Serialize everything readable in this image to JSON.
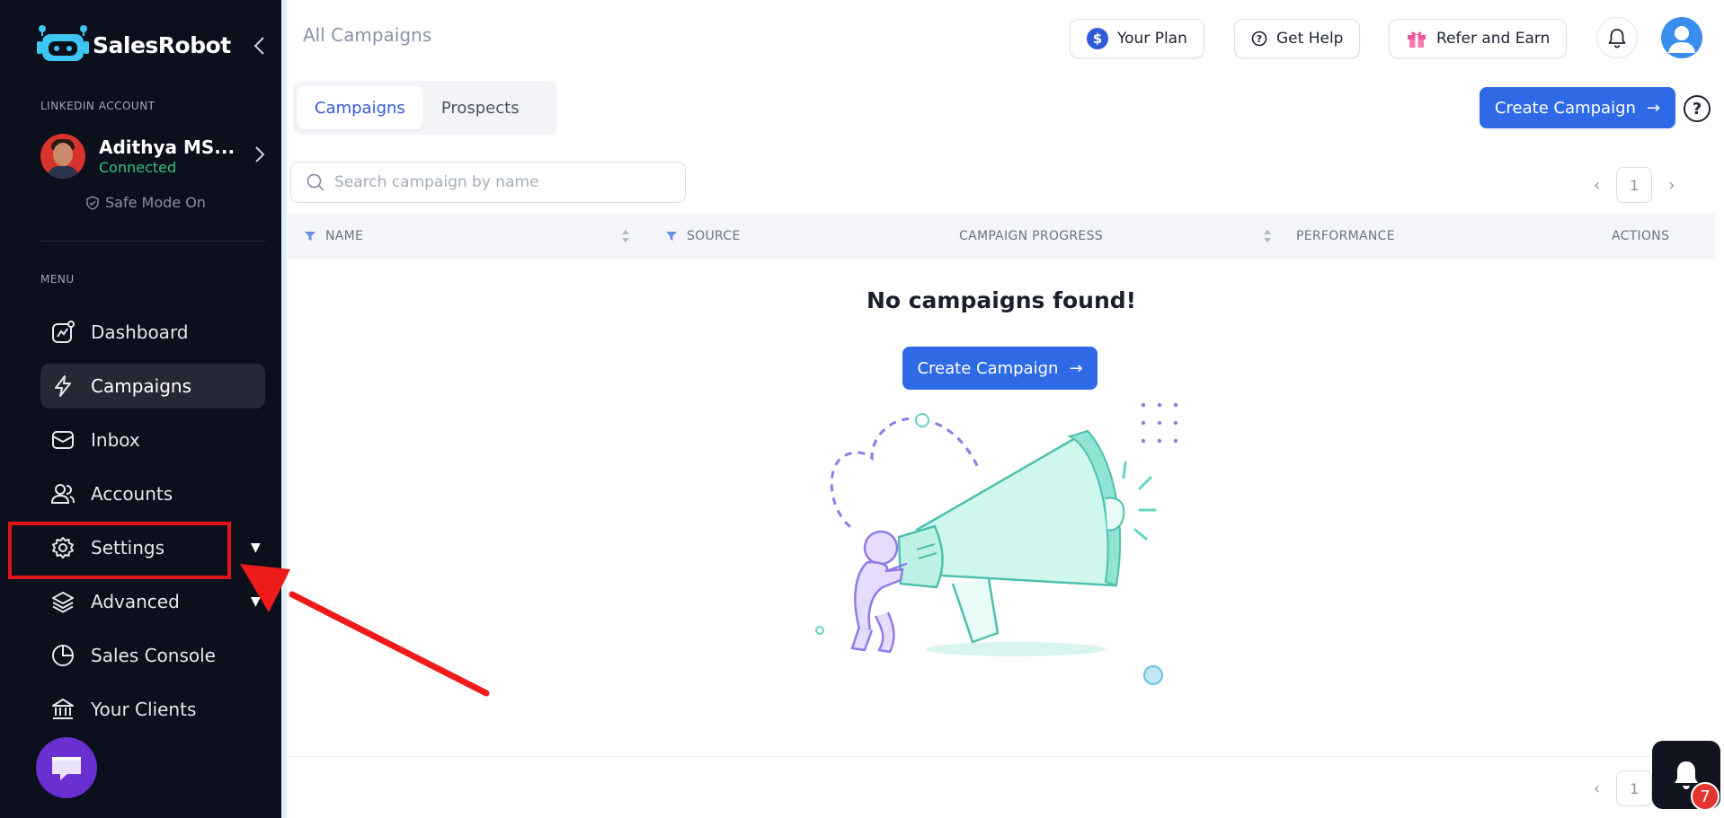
{
  "app": {
    "name": "SalesRobot"
  },
  "sidebar": {
    "linkedin_section_label": "LINKEDIN ACCOUNT",
    "account": {
      "name": "Adithya MS...",
      "status": "Connected"
    },
    "safe_mode": "Safe Mode On",
    "menu_label": "MENU",
    "items": [
      {
        "label": "Dashboard",
        "icon": "dashboard-icon"
      },
      {
        "label": "Campaigns",
        "icon": "lightning-icon",
        "active": true
      },
      {
        "label": "Inbox",
        "icon": "inbox-icon"
      },
      {
        "label": "Accounts",
        "icon": "users-icon"
      },
      {
        "label": "Settings",
        "icon": "gear-icon",
        "has_dropdown": true
      },
      {
        "label": "Advanced",
        "icon": "layers-icon",
        "has_dropdown": true
      },
      {
        "label": "Sales Console",
        "icon": "pie-chart-icon"
      },
      {
        "label": "Your Clients",
        "icon": "bank-icon"
      }
    ]
  },
  "header": {
    "breadcrumb": "All Campaigns",
    "buttons": {
      "plan": "Your Plan",
      "help": "Get Help",
      "refer": "Refer and Earn"
    }
  },
  "tabs": [
    {
      "label": "Campaigns",
      "active": true
    },
    {
      "label": "Prospects"
    }
  ],
  "create_campaign_label": "Create Campaign",
  "search": {
    "placeholder": "Search campaign by name"
  },
  "pagination": {
    "current_page": "1"
  },
  "table": {
    "columns": [
      "NAME",
      "SOURCE",
      "CAMPAIGN PROGRESS",
      "PERFORMANCE",
      "ACTIONS"
    ]
  },
  "empty_state": {
    "title": "No campaigns found!",
    "button": "Create Campaign"
  },
  "notifications": {
    "count": "7"
  },
  "colors": {
    "primary": "#2f6ae6",
    "sidebar_bg": "#0c0f1c",
    "connected": "#33c27f",
    "highlight": "#e01515"
  }
}
